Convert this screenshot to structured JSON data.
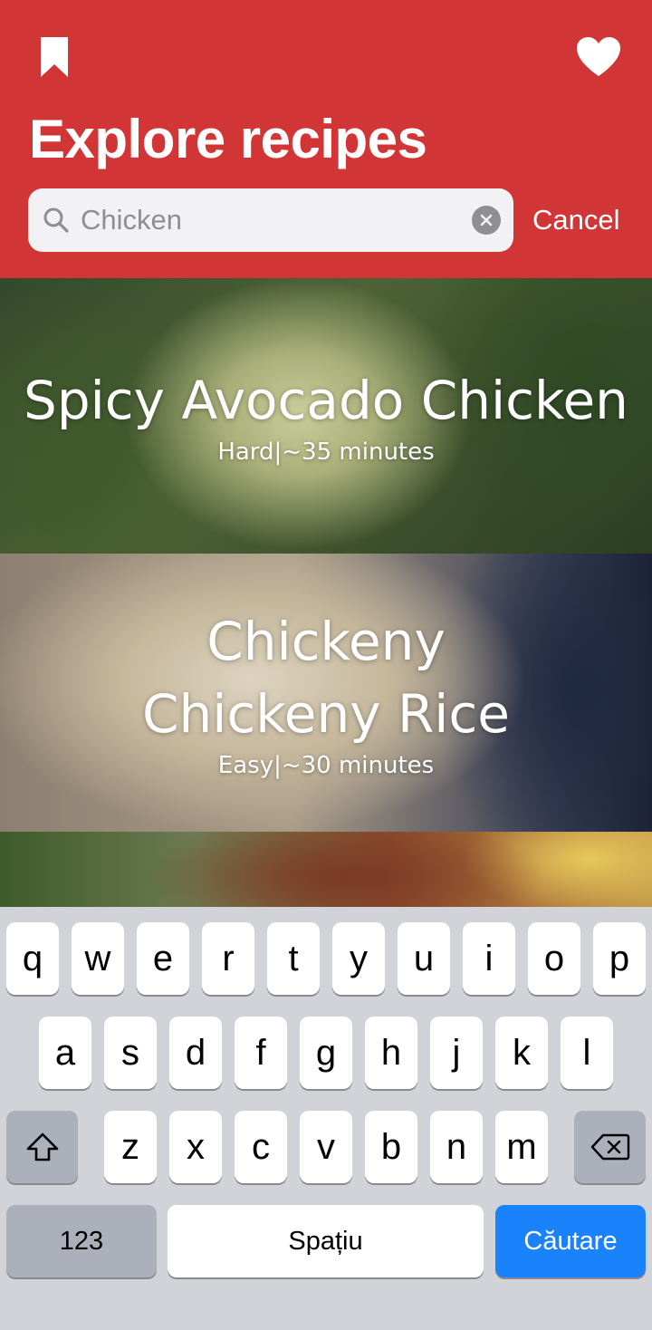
{
  "header": {
    "title": "Explore recipes",
    "bookmark_icon": "bookmark-icon",
    "favorites_icon": "heart-icon",
    "background_color": "#d23535"
  },
  "search": {
    "value": "Chicken",
    "placeholder": "Chicken",
    "cancel_label": "Cancel"
  },
  "recipes": [
    {
      "title": "Spicy Avocado Chicken",
      "meta": "Hard|~35 minutes"
    },
    {
      "title": "Chickeny Chickeny Rice",
      "meta": "Easy|~30 minutes"
    },
    {
      "title": "",
      "meta": ""
    }
  ],
  "keyboard": {
    "row1": [
      "q",
      "w",
      "e",
      "r",
      "t",
      "y",
      "u",
      "i",
      "o",
      "p"
    ],
    "row2": [
      "a",
      "s",
      "d",
      "f",
      "g",
      "h",
      "j",
      "k",
      "l"
    ],
    "row3": [
      "z",
      "x",
      "c",
      "v",
      "b",
      "n",
      "m"
    ],
    "numbers_label": "123",
    "space_label": "Spațiu",
    "search_label": "Căutare",
    "accent_color": "#1a82fb"
  }
}
